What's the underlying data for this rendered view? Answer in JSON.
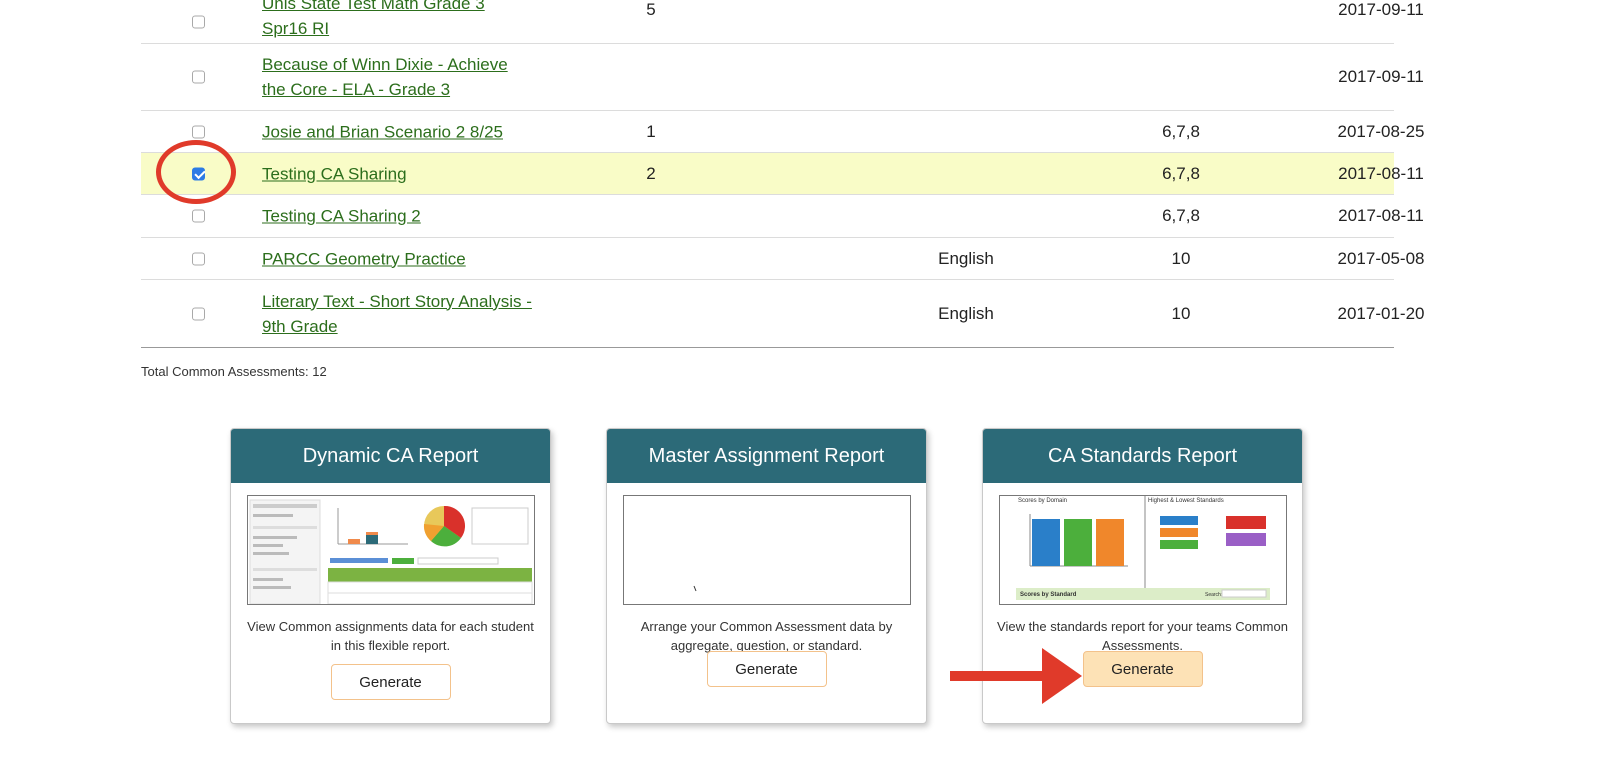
{
  "assessments": [
    {
      "title": "Unis State Test Math Grade 3 Spr16 RI",
      "questions": "5",
      "subject": "",
      "grades": "",
      "date": "2017-09-11",
      "checked": false
    },
    {
      "title": "Because of Winn Dixie - Achieve the Core - ELA - Grade 3",
      "questions": "",
      "subject": "",
      "grades": "",
      "date": "2017-09-11",
      "checked": false
    },
    {
      "title": "Josie and Brian Scenario 2 8/25",
      "questions": "1",
      "subject": "",
      "grades": "6,7,8",
      "date": "2017-08-25",
      "checked": false
    },
    {
      "title": "Testing CA Sharing",
      "questions": "2",
      "subject": "",
      "grades": "6,7,8",
      "date": "2017-08-11",
      "checked": true
    },
    {
      "title": "Testing CA Sharing 2",
      "questions": "",
      "subject": "",
      "grades": "6,7,8",
      "date": "2017-08-11",
      "checked": false
    },
    {
      "title": "PARCC Geometry Practice",
      "questions": "",
      "subject": "English",
      "grades": "10",
      "date": "2017-05-08",
      "checked": false
    },
    {
      "title": "Literary Text - Short Story Analysis - 9th Grade",
      "questions": "",
      "subject": "English",
      "grades": "10",
      "date": "2017-01-20",
      "checked": false
    }
  ],
  "total_label": "Total Common Assessments: 12",
  "reports": [
    {
      "title": "Dynamic CA Report",
      "description": "View Common assignments data for each student in this flexible report.",
      "button_label": "Generate"
    },
    {
      "title": "Master Assignment Report",
      "description": "Arrange your Common Assessment data by aggregate, question, or standard.",
      "button_label": "Generate"
    },
    {
      "title": "CA Standards Report",
      "description": "View the standards report for your teams Common Assessments.",
      "button_label": "Generate"
    }
  ],
  "thumb_text": {
    "scores_by_domain": "Scores by Domain",
    "highest_lowest": "Highest & Lowest Standards",
    "scores_by_standard": "Scores by Standard",
    "search": "Search:"
  },
  "colors": {
    "header": "#2c6a78",
    "link": "#2c6e1c",
    "selected_row": "#f9fcc7",
    "annotation": "#e03a2a",
    "button_active": "#fde2b6"
  }
}
